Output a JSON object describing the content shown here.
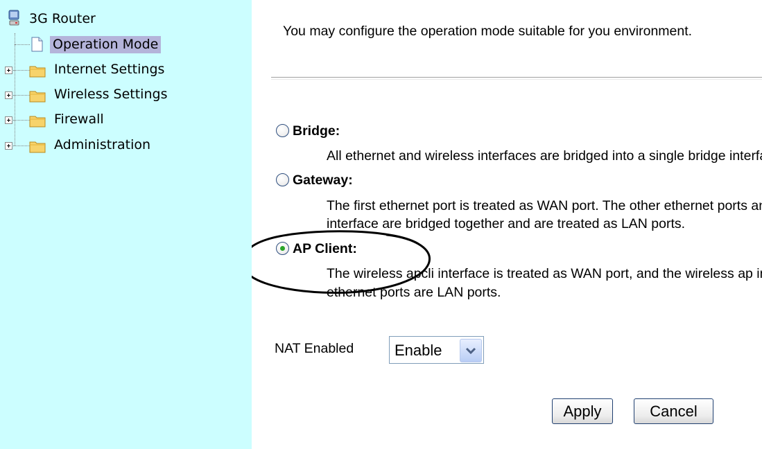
{
  "sidebar": {
    "root_label": "3G Router",
    "items": [
      {
        "label": "Operation Mode",
        "selected": true
      },
      {
        "label": "Internet Settings"
      },
      {
        "label": "Wireless Settings"
      },
      {
        "label": "Firewall"
      },
      {
        "label": "Administration"
      }
    ]
  },
  "main": {
    "intro": "You may configure the operation mode suitable for you environment.",
    "modes": [
      {
        "label": "Bridge:",
        "desc_lines": [
          "All ethernet and wireless interfaces are bridged into a single bridge interface."
        ],
        "selected": false
      },
      {
        "label": "Gateway:",
        "desc_lines": [
          "The first ethernet port is treated as WAN port. The other ethernet ports and the wireless",
          "interface are bridged together and are treated as LAN ports."
        ],
        "selected": false
      },
      {
        "label": "AP Client:",
        "desc_lines": [
          "The wireless apcli interface is treated as WAN port, and the wireless ap interface and the",
          "ethernet ports are LAN ports."
        ],
        "selected": true
      }
    ],
    "nat": {
      "label": "NAT Enabled",
      "value": "Enable"
    },
    "apply_label": "Apply",
    "cancel_label": "Cancel"
  },
  "colors": {
    "sidebar_bg": "#ccfeff",
    "selected_bg": "#b4b4da",
    "radio_dot": "#2aa52a"
  },
  "icons": {
    "root": "computer-icon",
    "page": "document-icon",
    "folder": "folder-icon",
    "expand": "plus-box-icon",
    "dropdown": "chevron-down-icon"
  }
}
